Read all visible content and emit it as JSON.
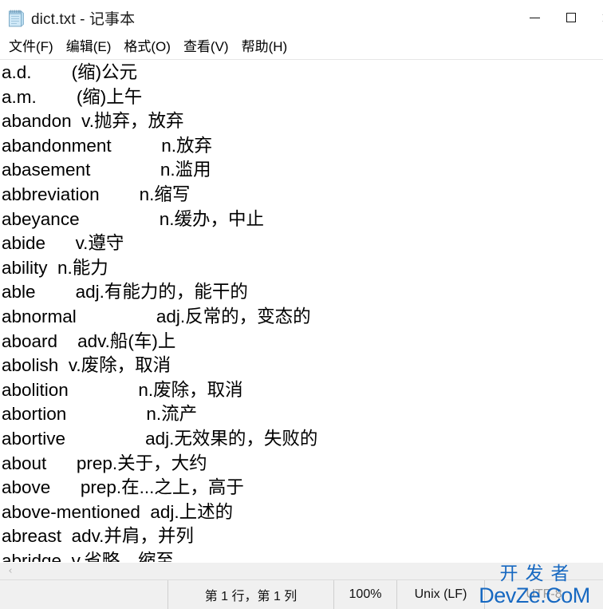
{
  "window": {
    "title": "dict.txt - 记事本",
    "icon": "notepad-icon",
    "controls": {
      "minimize_label": "—",
      "maximize_label": "□",
      "close_label": "✕"
    }
  },
  "menubar": {
    "items": [
      {
        "label": "文件(F)",
        "name": "menu-file"
      },
      {
        "label": "编辑(E)",
        "name": "menu-edit"
      },
      {
        "label": "格式(O)",
        "name": "menu-format"
      },
      {
        "label": "查看(V)",
        "name": "menu-view"
      },
      {
        "label": "帮助(H)",
        "name": "menu-help"
      }
    ]
  },
  "editor": {
    "lines": [
      "a.d.\t(缩)公元",
      "a.m.\t(缩)上午",
      "abandon\tv.抛弃，放弃",
      "abandonment\tn.放弃",
      "abasement\tn.滥用",
      "abbreviation\tn.缩写",
      "abeyance\tn.缓办，中止",
      "abide\tv.遵守",
      "ability\tn.能力",
      "able\tadj.有能力的，能干的",
      "abnormal\tadj.反常的，变态的",
      "aboard\tadv.船(车)上",
      "abolish\tv.废除，取消",
      "abolition\tn.废除，取消",
      "abortion\tn.流产",
      "abortive\tadj.无效果的，失败的",
      "about\tprep.关于，大约",
      "above\tprep.在...之上，高于",
      "above-mentioned\tadj.上述的",
      "abreast\tadv.并肩，并列",
      "abridge\tv.省略，缩至"
    ]
  },
  "scrollbar": {
    "left_arrow": "‹"
  },
  "statusbar": {
    "position": "第 1 行，第 1 列",
    "zoom": "100%",
    "line_ending": "Unix (LF)",
    "encoding": "UTF-8"
  },
  "watermark": {
    "line1": "开发者",
    "line2": "DevZe.CoM",
    "color": "#1668c1"
  }
}
